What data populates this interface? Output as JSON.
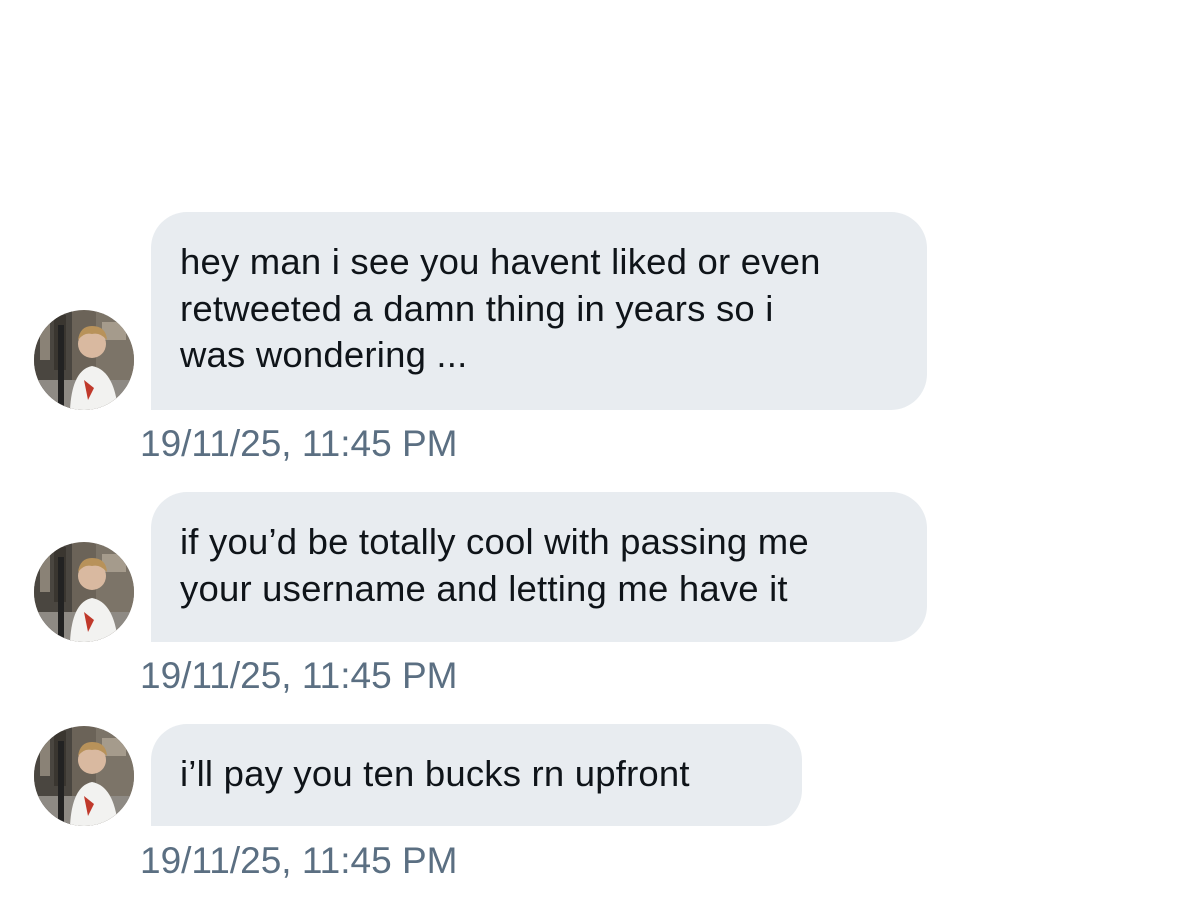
{
  "conversation": {
    "messages": [
      {
        "lines": [
          "hey man i see you havent liked or even",
          "retweeted a damn thing in years so i",
          "was wondering ..."
        ],
        "timestamp": "19/11/25, 11:45 PM",
        "avatar_icon": "user-photo-avatar"
      },
      {
        "lines": [
          "if you’d be totally cool with passing me",
          "your username and letting me have it"
        ],
        "timestamp": "19/11/25, 11:45 PM",
        "avatar_icon": "user-photo-avatar"
      },
      {
        "lines": [
          "i’ll pay you ten bucks rn upfront"
        ],
        "timestamp": "19/11/25, 11:45 PM",
        "avatar_icon": "user-photo-avatar"
      }
    ]
  },
  "colors": {
    "bubble_background": "#e8ecf0",
    "message_text": "#0f1419",
    "timestamp_text": "#5b6f82",
    "page_background": "#ffffff"
  }
}
